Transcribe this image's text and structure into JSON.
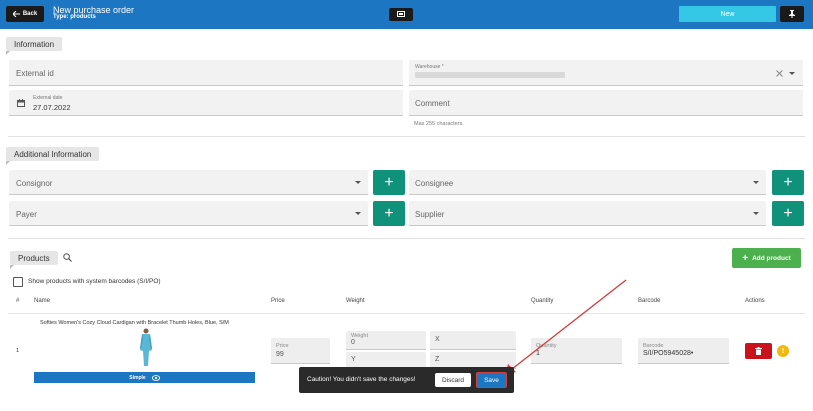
{
  "header": {
    "back_label": "Back",
    "title": "New purchase order",
    "subtitle": "Type: products",
    "status_label": "New"
  },
  "information": {
    "section_label": "Information",
    "external_id_label": "External id",
    "warehouse_label": "Warehouse *",
    "external_date_label": "External date",
    "external_date_value": "27.07.2022",
    "comment_label": "Comment",
    "comment_hint": "Max 255 characters."
  },
  "additional": {
    "section_label": "Additional Information",
    "consignor_label": "Consignor",
    "consignee_label": "Consignee",
    "payer_label": "Payer",
    "supplier_label": "Supplier"
  },
  "products": {
    "tab_label": "Products",
    "add_label": "Add product",
    "show_system_barcodes_label": "Show products with system barcodes (S/I/PO)",
    "columns": {
      "num": "#",
      "name": "Name",
      "price": "Price",
      "weight": "Weight",
      "quantity": "Quantity",
      "barcode": "Barcode",
      "actions": "Actions"
    },
    "rows": [
      {
        "index": "1",
        "name": "Softies Women's Cozy Cloud Cardigan with Bracelet Thumb Holes, Blue, S/M",
        "type_label": "Simple",
        "price_label": "Price",
        "price_value": "99",
        "weight_label": "Weight",
        "weight_value": "0",
        "x_label": "X",
        "y_label": "Y",
        "z_label": "Z",
        "quantity_label": "Quantity",
        "quantity_value": "1",
        "barcode_label": "Barcode",
        "barcode_value": "S/I/PO5945028•",
        "info_glyph": "!"
      }
    ]
  },
  "snackbar": {
    "message": "Caution! You didn't save the changes!",
    "discard_label": "Discard",
    "save_label": "Save"
  },
  "colors": {
    "header_blue": "#1d76c2",
    "status_cyan": "#35c8e6",
    "teal_button": "#10917a",
    "add_green": "#4cb04f",
    "delete_red": "#c9121b",
    "info_yellow": "#f0b90b",
    "annotation_red": "#d23f3f"
  },
  "icons": [
    "arrow-left-icon",
    "print-icon",
    "pin-icon",
    "calendar-icon",
    "close-icon",
    "chevron-down-icon",
    "plus-icon",
    "search-icon",
    "eye-icon",
    "trash-icon",
    "info-icon"
  ]
}
